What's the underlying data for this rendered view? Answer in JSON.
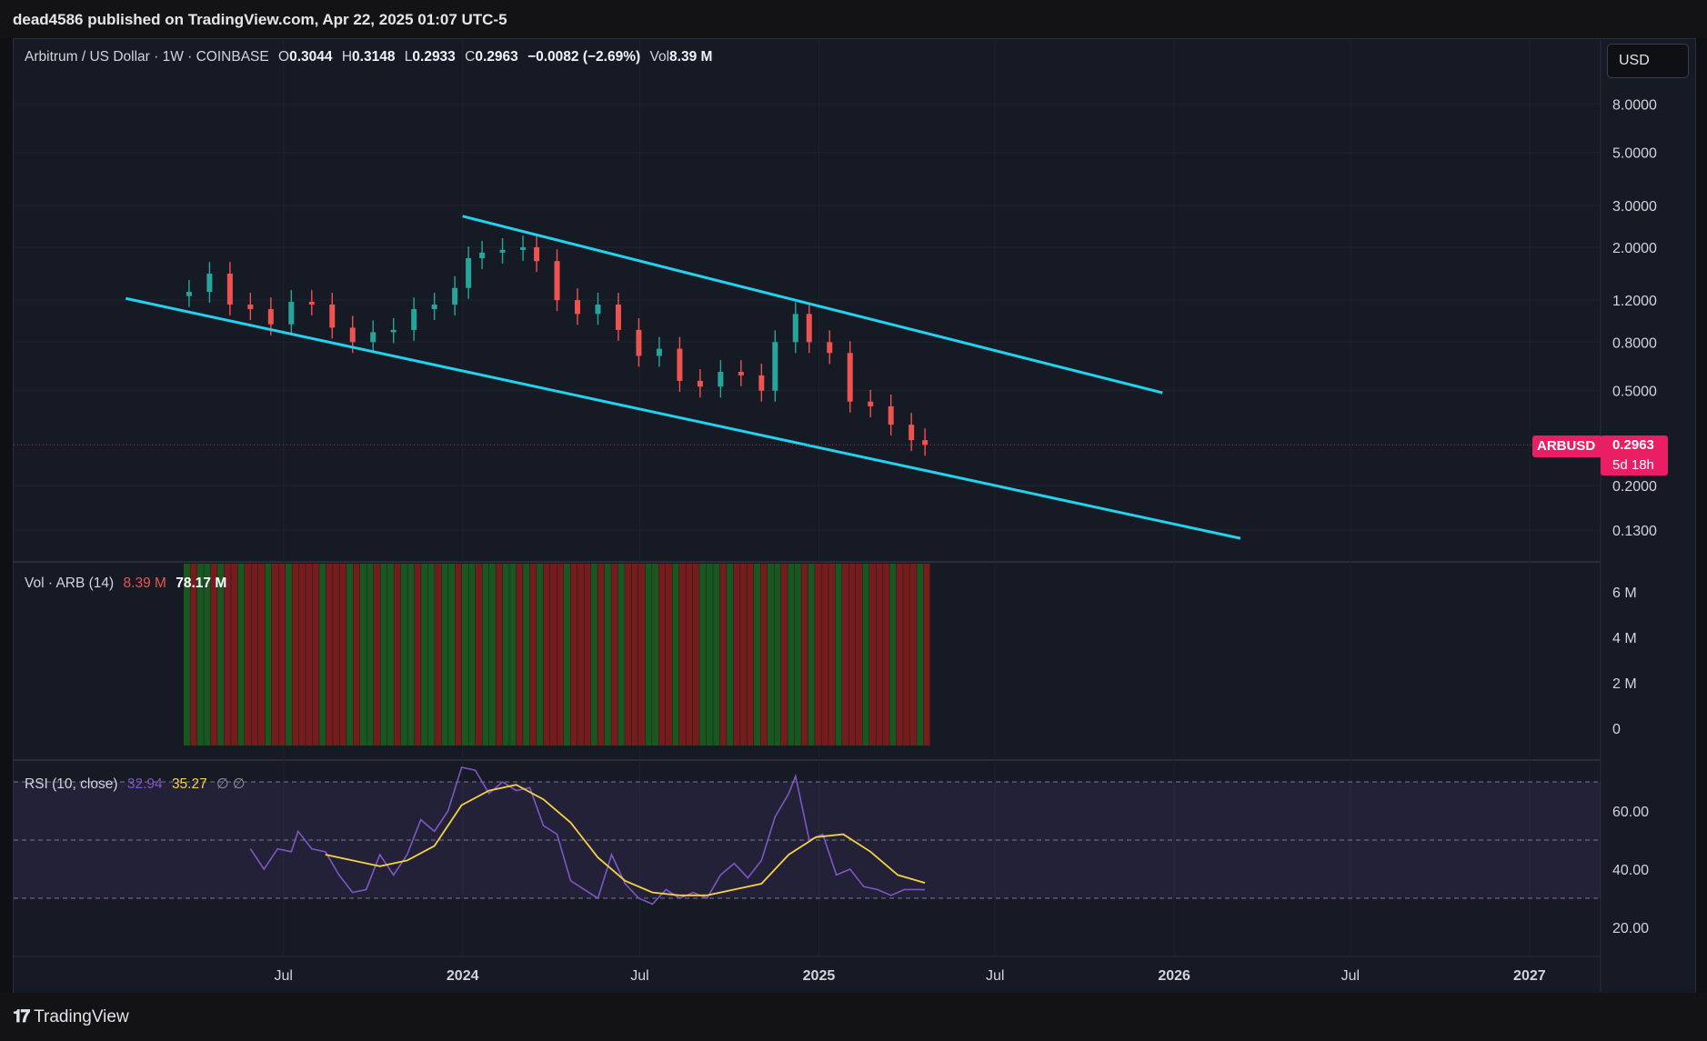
{
  "publisher": "dead4586 published on TradingView.com, Apr 22, 2025 01:07 UTC-5",
  "legend": {
    "symbol": "Arbitrum / US Dollar · 1W · COINBASE",
    "o_label": "O",
    "o": "0.3044",
    "h_label": "H",
    "h": "0.3148",
    "l_label": "L",
    "l": "0.2933",
    "c_label": "C",
    "c": "0.2963",
    "change": "−0.0082 (−2.69%)",
    "vol_label": "Vol",
    "vol": "8.39 M"
  },
  "currency": "USD",
  "ticker_tag": "ARBUSD",
  "last_price": "0.2963",
  "countdown": "5d 18h",
  "volume_legend": {
    "name": "Vol · ARB (14)",
    "value": "8.39 M",
    "ma": "78.17 M"
  },
  "rsi_legend": {
    "name": "RSI (10, close)",
    "rsi": "32.94",
    "ma": "35.27",
    "extra": "∅ ∅"
  },
  "brand": "TradingView",
  "colors": {
    "up": "#26a69a",
    "down": "#ef5350",
    "channel": "#22d3ee",
    "rsi": "#7e57c2",
    "rsi_ma": "#f5d142",
    "tag": "#e91e63"
  },
  "chart_data": [
    {
      "type": "candlestick",
      "title": "Arbitrum / US Dollar · 1W · COINBASE",
      "y_scale": "log",
      "y_ticks": [
        "8.0000",
        "5.0000",
        "3.0000",
        "2.0000",
        "1.2000",
        "0.8000",
        "0.5000",
        "0.2000",
        "0.1300"
      ],
      "x_ticks": [
        "Jul",
        "2024",
        "Jul",
        "2025",
        "Jul",
        "2026",
        "Jul",
        "2027"
      ],
      "x_range": [
        "2023-01-01",
        "2027-03-01"
      ],
      "series": [
        {
          "name": "ARBUSD",
          "close_points": [
            [
              "2023-03-26",
              1.3
            ],
            [
              "2023-04-16",
              1.55
            ],
            [
              "2023-05-07",
              1.15
            ],
            [
              "2023-05-28",
              1.1
            ],
            [
              "2023-06-18",
              0.95
            ],
            [
              "2023-07-09",
              1.18
            ],
            [
              "2023-07-30",
              1.15
            ],
            [
              "2023-08-20",
              0.92
            ],
            [
              "2023-09-10",
              0.8
            ],
            [
              "2023-10-01",
              0.88
            ],
            [
              "2023-10-22",
              0.9
            ],
            [
              "2023-11-12",
              1.1
            ],
            [
              "2023-12-03",
              1.15
            ],
            [
              "2023-12-24",
              1.35
            ],
            [
              "2024-01-07",
              1.8
            ],
            [
              "2024-01-21",
              1.9
            ],
            [
              "2024-02-11",
              1.95
            ],
            [
              "2024-03-03",
              2.0
            ],
            [
              "2024-03-17",
              1.75
            ],
            [
              "2024-04-07",
              1.2
            ],
            [
              "2024-04-28",
              1.05
            ],
            [
              "2024-05-19",
              1.15
            ],
            [
              "2024-06-09",
              0.9
            ],
            [
              "2024-06-30",
              0.7
            ],
            [
              "2024-07-21",
              0.75
            ],
            [
              "2024-08-11",
              0.55
            ],
            [
              "2024-09-01",
              0.52
            ],
            [
              "2024-09-22",
              0.6
            ],
            [
              "2024-10-13",
              0.58
            ],
            [
              "2024-11-03",
              0.5
            ],
            [
              "2024-11-17",
              0.8
            ],
            [
              "2024-12-08",
              1.05
            ],
            [
              "2024-12-22",
              0.8
            ],
            [
              "2025-01-12",
              0.72
            ],
            [
              "2025-02-02",
              0.45
            ],
            [
              "2025-02-23",
              0.43
            ],
            [
              "2025-03-16",
              0.36
            ],
            [
              "2025-04-06",
              0.31
            ],
            [
              "2025-04-20",
              0.2963
            ]
          ]
        }
      ],
      "channel": {
        "upper": [
          [
            "2024-01-01",
            2.7
          ],
          [
            "2025-12-20",
            0.49
          ]
        ],
        "lower": [
          [
            "2023-01-20",
            1.22
          ],
          [
            "2026-03-10",
            0.12
          ]
        ]
      },
      "last_price": 0.2963
    },
    {
      "type": "bar",
      "title": "Vol · ARB (14)",
      "y_ticks": [
        "6 M",
        "4 M",
        "2 M",
        "0"
      ],
      "x_range": [
        "2023-03-26",
        "2025-04-20"
      ]
    },
    {
      "type": "line",
      "title": "RSI (10, close)",
      "y_ticks": [
        "60.00",
        "40.00",
        "20.00"
      ],
      "bands": [
        70,
        50,
        30
      ],
      "series": [
        {
          "name": "RSI",
          "points": [
            [
              "2023-05-28",
              47
            ],
            [
              "2023-06-11",
              40
            ],
            [
              "2023-06-25",
              47
            ],
            [
              "2023-07-09",
              46
            ],
            [
              "2023-07-16",
              53
            ],
            [
              "2023-07-30",
              47
            ],
            [
              "2023-08-13",
              46
            ],
            [
              "2023-08-27",
              38
            ],
            [
              "2023-09-10",
              32
            ],
            [
              "2023-09-24",
              33
            ],
            [
              "2023-10-08",
              45
            ],
            [
              "2023-10-22",
              38
            ],
            [
              "2023-11-05",
              45
            ],
            [
              "2023-11-19",
              57
            ],
            [
              "2023-12-03",
              53
            ],
            [
              "2023-12-17",
              60
            ],
            [
              "2023-12-31",
              75
            ],
            [
              "2024-01-14",
              74
            ],
            [
              "2024-01-28",
              66
            ],
            [
              "2024-02-11",
              70
            ],
            [
              "2024-02-25",
              67
            ],
            [
              "2024-03-10",
              68
            ],
            [
              "2024-03-24",
              55
            ],
            [
              "2024-04-07",
              52
            ],
            [
              "2024-04-21",
              36
            ],
            [
              "2024-05-05",
              33
            ],
            [
              "2024-05-19",
              30
            ],
            [
              "2024-06-02",
              45
            ],
            [
              "2024-06-16",
              35
            ],
            [
              "2024-06-30",
              30
            ],
            [
              "2024-07-14",
              28
            ],
            [
              "2024-07-28",
              33
            ],
            [
              "2024-08-11",
              30
            ],
            [
              "2024-08-25",
              32
            ],
            [
              "2024-09-08",
              30
            ],
            [
              "2024-09-22",
              38
            ],
            [
              "2024-10-06",
              42
            ],
            [
              "2024-10-20",
              37
            ],
            [
              "2024-11-03",
              43
            ],
            [
              "2024-11-17",
              58
            ],
            [
              "2024-12-01",
              66
            ],
            [
              "2024-12-08",
              72
            ],
            [
              "2024-12-22",
              50
            ],
            [
              "2025-01-05",
              52
            ],
            [
              "2025-01-19",
              38
            ],
            [
              "2025-02-02",
              40
            ],
            [
              "2025-02-16",
              34
            ],
            [
              "2025-03-02",
              33
            ],
            [
              "2025-03-16",
              31
            ],
            [
              "2025-03-30",
              33
            ],
            [
              "2025-04-13",
              33
            ],
            [
              "2025-04-20",
              32.94
            ]
          ]
        },
        {
          "name": "MA",
          "points": [
            [
              "2023-08-13",
              45
            ],
            [
              "2023-09-10",
              43
            ],
            [
              "2023-10-08",
              41
            ],
            [
              "2023-11-05",
              43
            ],
            [
              "2023-12-03",
              48
            ],
            [
              "2023-12-31",
              62
            ],
            [
              "2024-01-28",
              67
            ],
            [
              "2024-02-25",
              69
            ],
            [
              "2024-03-24",
              64
            ],
            [
              "2024-04-21",
              56
            ],
            [
              "2024-05-19",
              44
            ],
            [
              "2024-06-16",
              36
            ],
            [
              "2024-07-14",
              32
            ],
            [
              "2024-08-11",
              31
            ],
            [
              "2024-09-08",
              31
            ],
            [
              "2024-10-06",
              33
            ],
            [
              "2024-11-03",
              35
            ],
            [
              "2024-12-01",
              45
            ],
            [
              "2024-12-29",
              51
            ],
            [
              "2025-01-26",
              52
            ],
            [
              "2025-02-23",
              46
            ],
            [
              "2025-03-23",
              38
            ],
            [
              "2025-04-20",
              35.27
            ]
          ]
        }
      ]
    }
  ]
}
